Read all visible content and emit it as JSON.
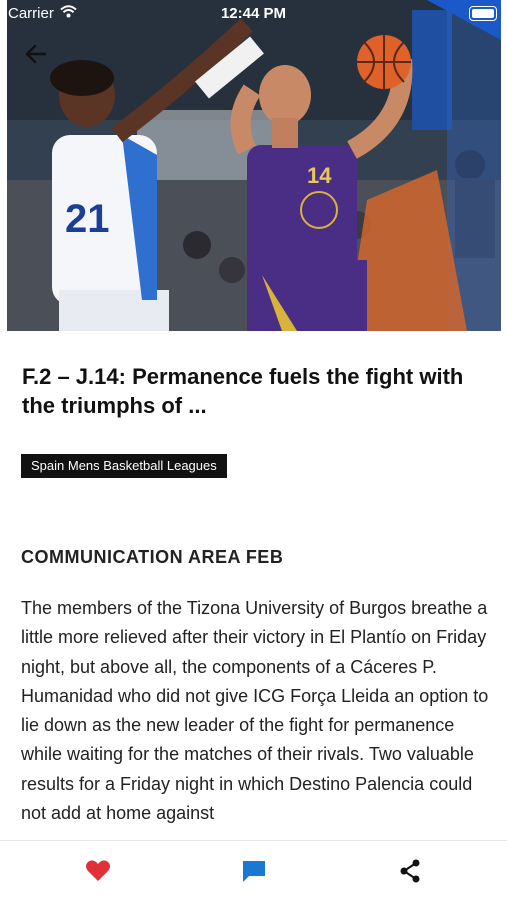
{
  "status_bar": {
    "carrier": "Carrier",
    "time": "12:44 PM"
  },
  "article": {
    "title": "F.2 – J.14: Permanence fuels the fight with the triumphs of ...",
    "category_tag": "Spain Mens Basketball Leagues",
    "author": "COMMUNICATION AREA FEB",
    "body": "The members of the Tizona University of Burgos breathe a little more relieved after their victory in El Plantío on Friday night, but above all, the components of a Cáceres P. Humanidad who did not give ICG Força Lleida an option to lie down as the new leader of the fight for permanence while waiting for the matches of their rivals. Two valuable results for a Friday night in which Destino Palencia could not add at home against"
  },
  "hero_image": {
    "jersey_left_number": "21",
    "jersey_right_number": "14"
  },
  "colors": {
    "like": "#e0313a",
    "comment": "#1a78d4",
    "share": "#111111",
    "tag_bg": "#111111"
  },
  "icons": {
    "back": "back-arrow-icon",
    "like": "heart-icon",
    "comment": "comment-icon",
    "share": "share-icon"
  }
}
